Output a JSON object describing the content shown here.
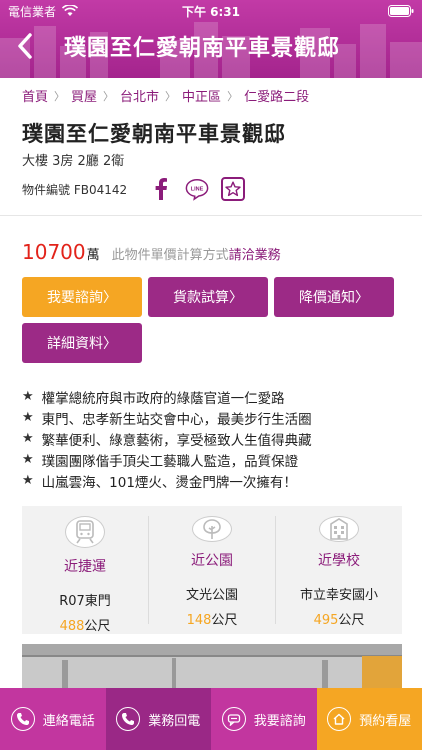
{
  "status_bar": {
    "carrier": "電信業者",
    "time": "下午 6:31"
  },
  "nav": {
    "title": "璞園至仁愛朝南平車景觀邸"
  },
  "breadcrumb": [
    "首頁",
    "買屋",
    "台北市",
    "中正區",
    "仁愛路二段"
  ],
  "listing": {
    "title": "璞園至仁愛朝南平車景觀邸",
    "layout": "大樓 3房 2廳 2衛",
    "object_id": "物件編號 FB04142",
    "price": "10700",
    "price_unit": "萬",
    "price_note": "此物件單價計算方式",
    "price_link": "請洽業務"
  },
  "actions": {
    "consult": "我要諮詢〉",
    "loan": "貨款試算〉",
    "price_alert": "降價通知〉",
    "details": "詳細資料〉"
  },
  "features": [
    "權掌總統府與市政府的綠蔭官道一仁愛路",
    "東門、忠孝新生站交會中心，最美步行生活圈",
    "繁華便利、綠意藝術，享受極致人生值得典藏",
    "璞園團隊偕手頂尖工藝職人監造，品質保證",
    "山嵐雲海、101煙火、燙金門牌一次擁有！"
  ],
  "poi": [
    {
      "label": "近捷運",
      "name": "R07東門",
      "distance": "488",
      "unit": "公尺"
    },
    {
      "label": "近公園",
      "name": "文光公園",
      "distance": "148",
      "unit": "公尺"
    },
    {
      "label": "近學校",
      "name": "市立幸安國小",
      "distance": "495",
      "unit": "公尺"
    }
  ],
  "bottom_bar": {
    "call": "連絡電話",
    "callback": "業務回電",
    "consult": "我要諮詢",
    "book": "預約看屋"
  },
  "colors": {
    "purple": "#9c2a86",
    "magenta": "#c2369f",
    "orange": "#f5a623",
    "price_red": "#e2231a"
  }
}
